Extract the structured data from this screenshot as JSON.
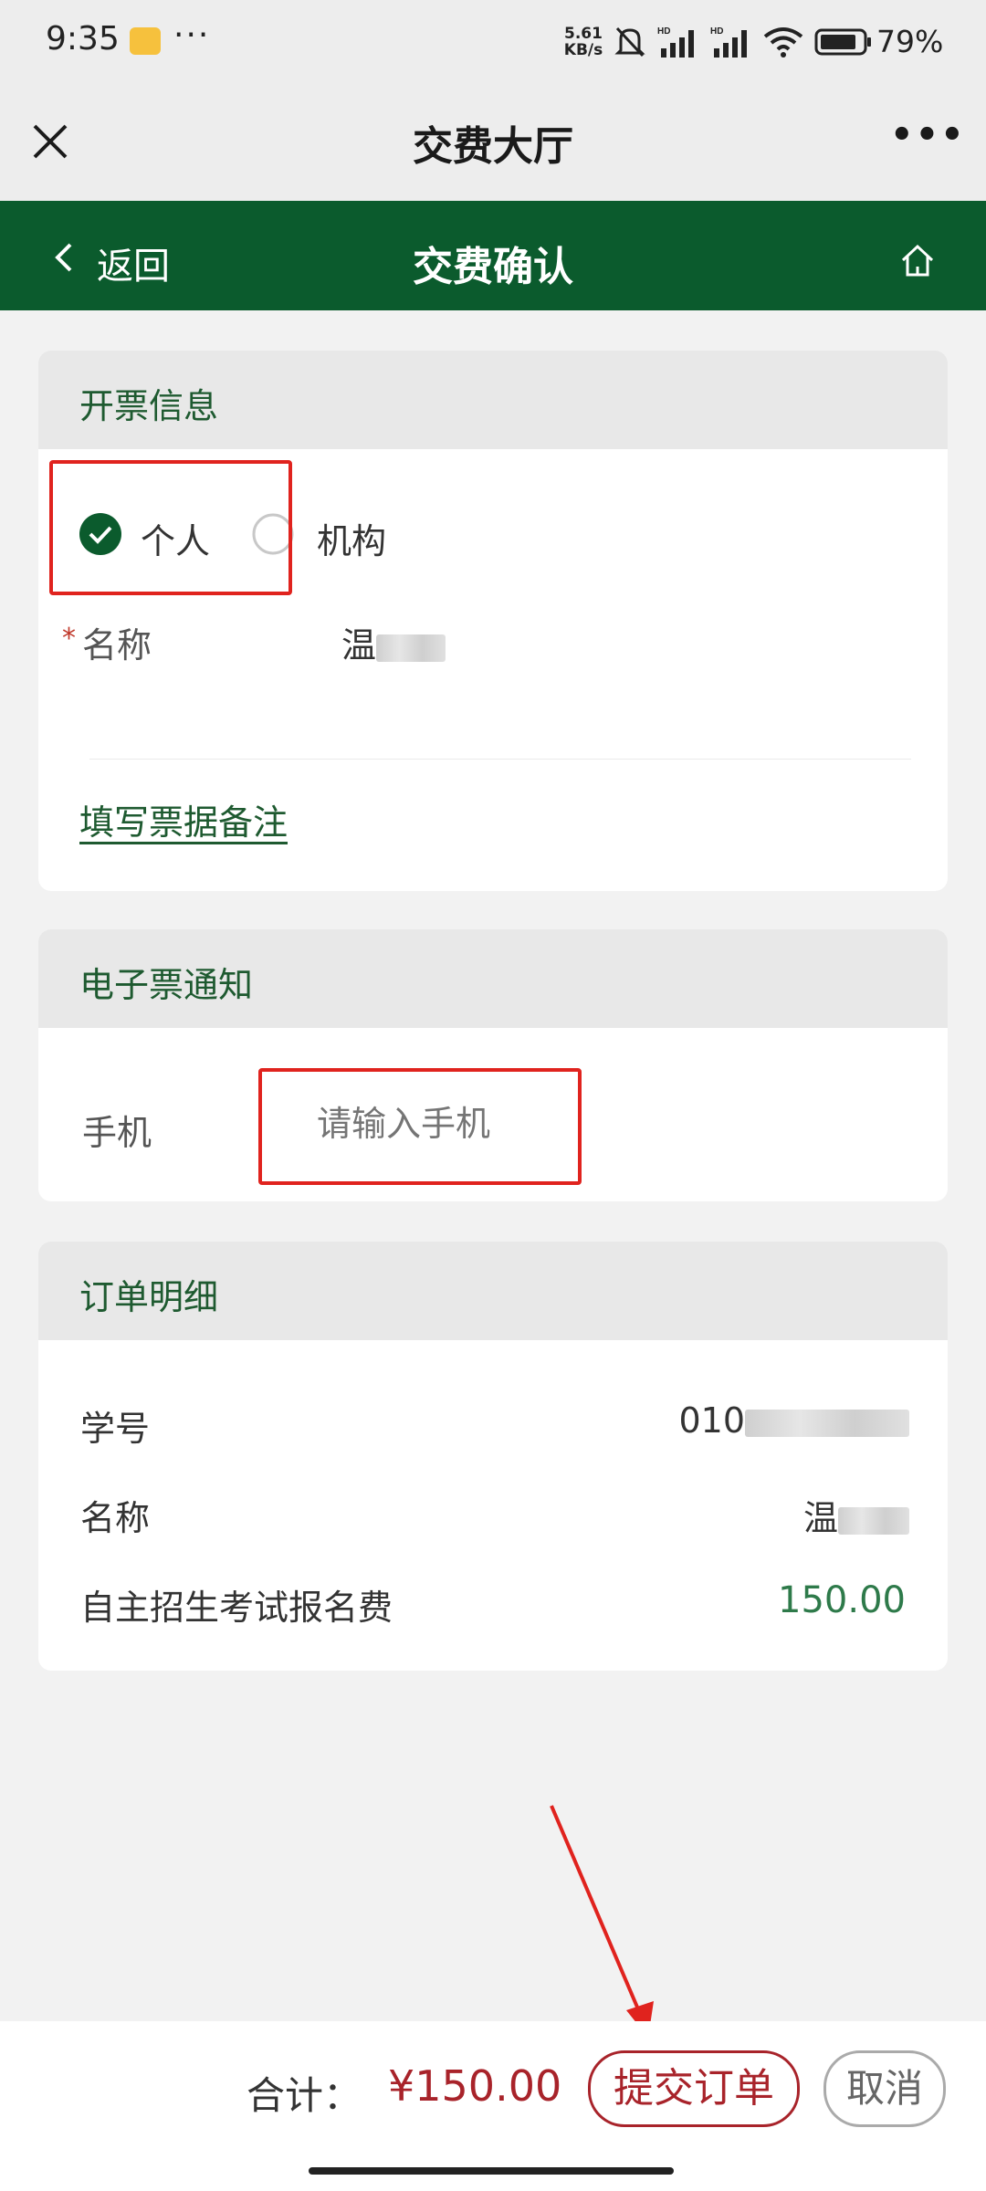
{
  "status": {
    "time": "9:35",
    "more": "···",
    "net_rate_value": "5.61",
    "net_rate_unit": "KB/s",
    "battery_pct": "79%"
  },
  "wechat": {
    "title": "交费大厅",
    "menu": "•••"
  },
  "nav": {
    "back_label": "返回",
    "title": "交费确认"
  },
  "invoice": {
    "heading": "开票信息",
    "option_personal": "个人",
    "option_org": "机构",
    "selected": "个人",
    "name_required_mark": "*",
    "name_label": "名称",
    "name_value_visible": "温",
    "remark_link": "填写票据备注"
  },
  "notify": {
    "heading": "电子票通知",
    "phone_label": "手机",
    "phone_placeholder": "请输入手机"
  },
  "order": {
    "heading": "订单明细",
    "rows": [
      {
        "label": "学号",
        "value": "010"
      },
      {
        "label": "名称",
        "value": "温"
      },
      {
        "label": "自主招生考试报名费",
        "value": "150.00"
      }
    ]
  },
  "footer": {
    "total_label": "合计：",
    "total_value": "¥150.00",
    "submit_label": "提交订单",
    "cancel_label": "取消"
  },
  "colors": {
    "brand_green": "#0b5b2d",
    "accent_red": "#a8232a",
    "annotation_red": "#e0231e"
  }
}
